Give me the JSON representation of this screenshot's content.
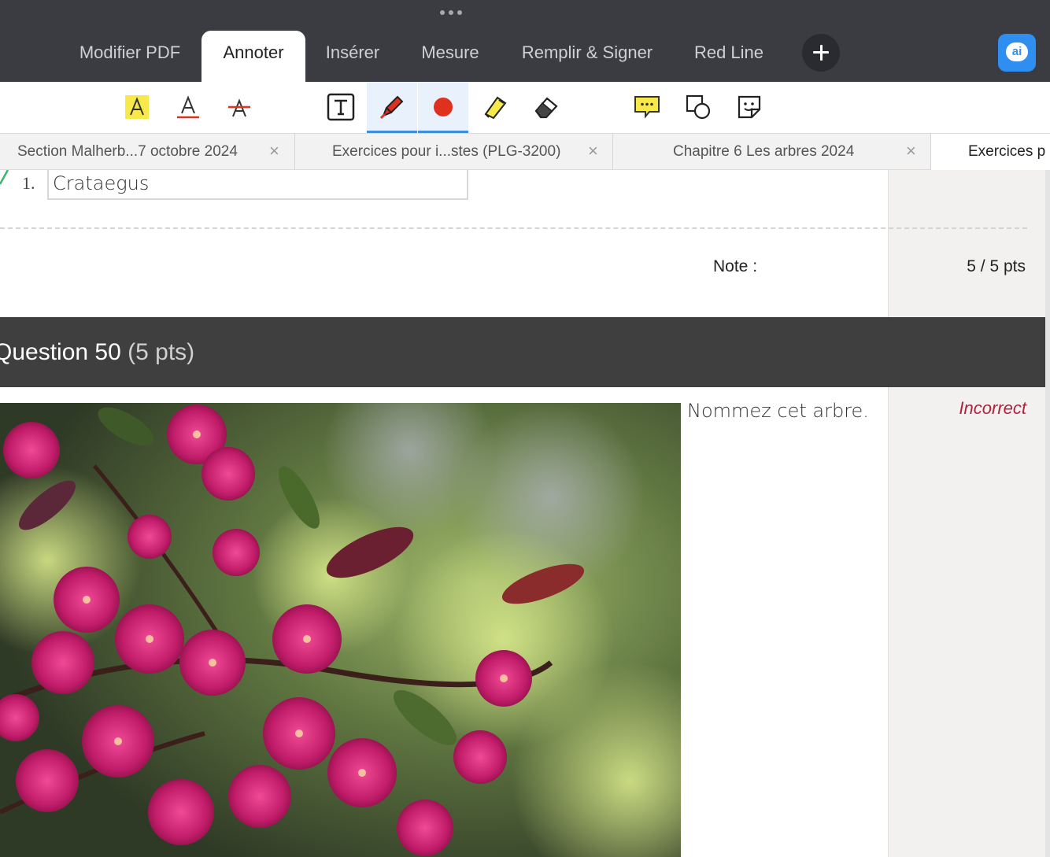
{
  "menu": {
    "tabs": [
      {
        "label": "Modifier PDF"
      },
      {
        "label": "Annoter"
      },
      {
        "label": "Insérer"
      },
      {
        "label": "Mesure"
      },
      {
        "label": "Remplir & Signer"
      },
      {
        "label": "Red Line"
      }
    ],
    "active_tab": "Annoter",
    "ai_label": "ai"
  },
  "toolbar": {
    "tools": [
      {
        "icon": "highlight-text-icon"
      },
      {
        "icon": "underline-text-icon"
      },
      {
        "icon": "strikethrough-text-icon"
      },
      {
        "icon": "text-box-icon"
      },
      {
        "icon": "pen-icon",
        "selected": true
      },
      {
        "icon": "color-dot-icon",
        "selected": true
      },
      {
        "icon": "highlighter-icon"
      },
      {
        "icon": "eraser-icon"
      },
      {
        "icon": "comment-icon"
      },
      {
        "icon": "shapes-icon"
      },
      {
        "icon": "sticker-icon"
      }
    ],
    "pen_color": "#e0301e",
    "highlight_color": "#f7e94a"
  },
  "doc_tabs": [
    {
      "label": "Section Malherb...7 octobre 2024",
      "close": "×"
    },
    {
      "label": "Exercices pour i...stes (PLG-3200)",
      "close": "×"
    },
    {
      "label": "Chapitre 6 Les arbres  2024",
      "close": "×"
    },
    {
      "label": "Exercices p"
    }
  ],
  "document": {
    "answer_number": "1.",
    "answer_value": "Crataegus",
    "note_label": "Note :",
    "note_value": "5 / 5 pts",
    "question_title": "Question 50",
    "question_points": "(5 pts)",
    "question_text": "Nommez cet arbre.",
    "status": "Incorrect",
    "status_color": "#b0213a"
  }
}
